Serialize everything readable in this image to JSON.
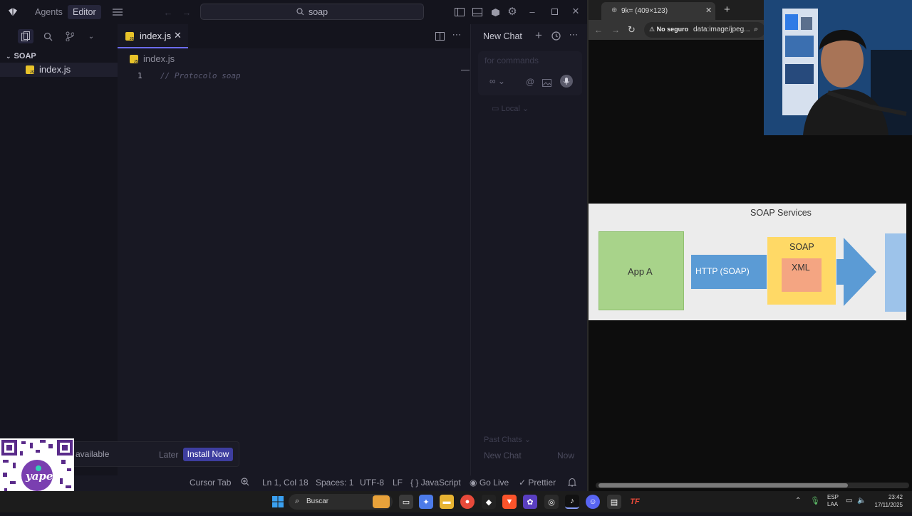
{
  "titlebar": {
    "tab_agents": "Agents",
    "tab_editor": "Editor",
    "search_value": "soap"
  },
  "sidebar": {
    "folder_name": "SOAP",
    "file_name": "index.js"
  },
  "editor": {
    "tab_label": "index.js",
    "breadcrumb": "index.js",
    "line_number": "1",
    "line_text": "// Protocolo soap"
  },
  "chat": {
    "new_chat_label": "New Chat",
    "input_placeholder": "for commands",
    "local_label": "Local",
    "past_chats_label": "Past Chats",
    "history_item": "New Chat",
    "history_time": "Now"
  },
  "notification": {
    "text": "available",
    "later_label": "Later",
    "install_label": "Install Now"
  },
  "statusbar": {
    "cursor_tab": "Cursor Tab",
    "position": "Ln 1, Col 18",
    "spaces": "Spaces: 1",
    "encoding": "UTF-8",
    "eol": "LF",
    "language": "JavaScript",
    "go_live": "Go Live",
    "prettier": "Prettier"
  },
  "browser": {
    "tab_title": "9k= (409×123)",
    "security_label": "No seguro",
    "url": "data:image/jpeg..."
  },
  "diagram": {
    "title": "SOAP Services",
    "app_a": "App A",
    "http_label": "HTTP (SOAP)",
    "soap_label": "SOAP",
    "xml_label": "XML"
  },
  "taskbar": {
    "search_label": "Buscar",
    "lang_line1": "ESP",
    "lang_line2": "LAA",
    "time": "23:42",
    "date": "17/11/2025"
  },
  "qr": {
    "brand": "yape"
  },
  "colors": {
    "accent": "#3e3e9f",
    "js_badge": "#e8c32a",
    "app_a_box": "#a8d38a",
    "http_box": "#5b9bd5",
    "soap_box": "#ffd966",
    "xml_box": "#f4a582"
  }
}
